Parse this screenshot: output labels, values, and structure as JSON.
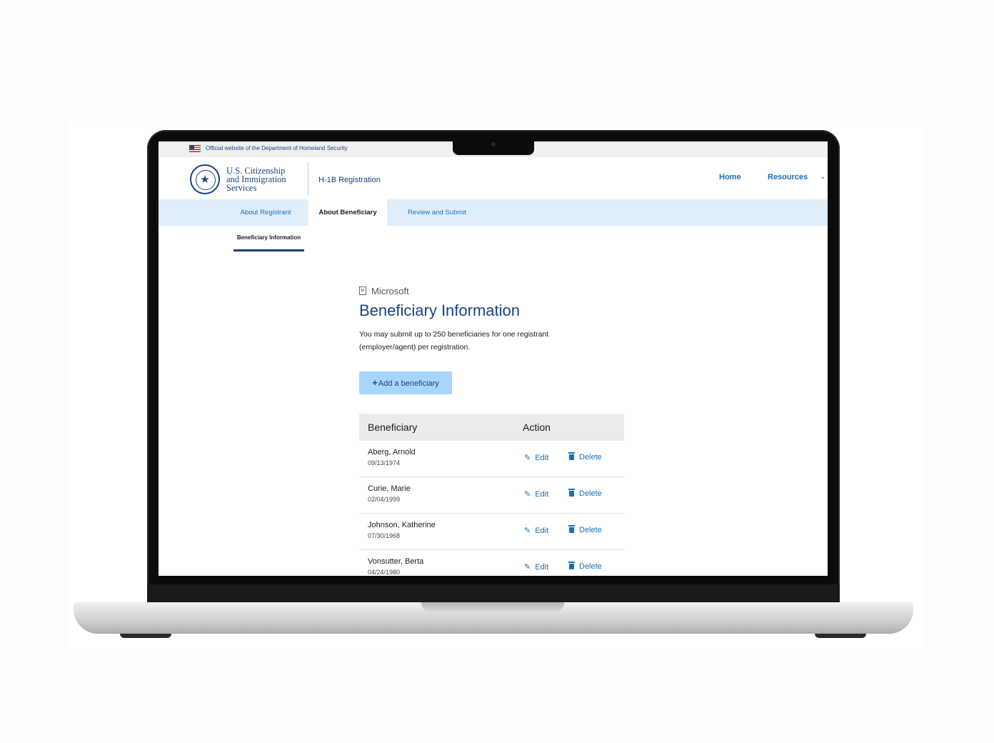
{
  "gov_banner": {
    "text": "Official website of the Department of Homeland Security"
  },
  "header": {
    "agency_lines": [
      "U.S. Citizenship",
      "and Immigration",
      "Services"
    ],
    "app_name": "H-1B Registration",
    "nav": {
      "home": "Home",
      "resources": "Resources"
    }
  },
  "tabs": [
    {
      "label": "About Registrant",
      "active": false
    },
    {
      "label": "About Beneficiary",
      "active": true
    },
    {
      "label": "Review and Submit",
      "active": false
    }
  ],
  "subnav": {
    "label": "Beneficiary Information"
  },
  "main": {
    "organization": "Microsoft",
    "title": "Beneficiary Information",
    "intro": "You may submit up to 250 beneficiaries for one registrant (employer/agent) per registration.",
    "add_button": "Add a beneficiary"
  },
  "table": {
    "headers": [
      "Beneficiary",
      "Action"
    ],
    "rows": [
      {
        "name": "Aberg, Arnold",
        "dob": "09/13/1974"
      },
      {
        "name": "Curie, Marie",
        "dob": "02/04/1999"
      },
      {
        "name": "Johnson, Katherine",
        "dob": "07/30/1968"
      },
      {
        "name": "Vonsutter, Berta",
        "dob": "04/24/1980"
      }
    ],
    "edit_label": "Edit",
    "delete_label": "Delete"
  },
  "colors": {
    "brand_navy": "#1a4480",
    "link_blue": "#1a6fb3",
    "tab_bar": "#dfeefb",
    "button_bg": "#a8d6fb"
  }
}
